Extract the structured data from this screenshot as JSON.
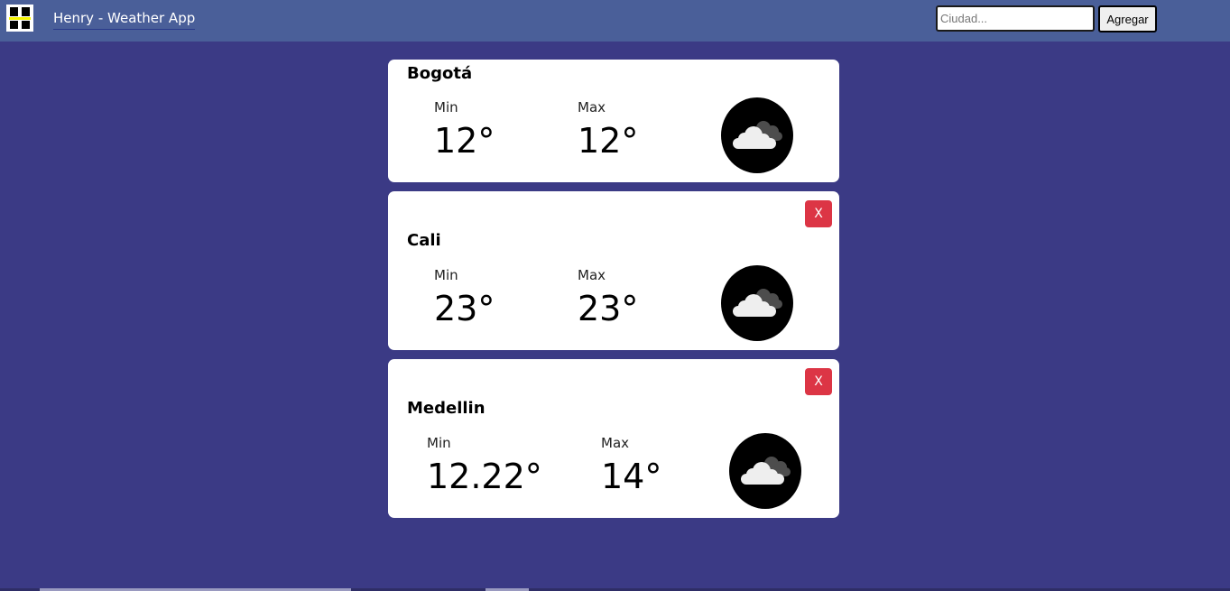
{
  "header": {
    "title": "Henry - Weather App",
    "logo_icon": "henry-logo-icon",
    "search": {
      "placeholder": "Ciudad...",
      "value": ""
    },
    "add_button_label": "Agregar"
  },
  "cities": [
    {
      "name": "Bogotá",
      "min_label": "Min",
      "min_value": "12°",
      "max_label": "Max",
      "max_value": "12°",
      "icon": "broken-clouds-icon",
      "close_label": ""
    },
    {
      "name": "Cali",
      "min_label": "Min",
      "min_value": "23°",
      "max_label": "Max",
      "max_value": "23°",
      "icon": "broken-clouds-icon",
      "close_label": "X"
    },
    {
      "name": "Medellin",
      "min_label": "Min",
      "min_value": "12.22°",
      "max_label": "Max",
      "max_value": "14°",
      "icon": "broken-clouds-icon",
      "close_label": "X"
    }
  ],
  "colors": {
    "background": "#3b3a85",
    "navbar": "#4a5f99",
    "close_button": "#dc3545",
    "card": "#ffffff"
  }
}
